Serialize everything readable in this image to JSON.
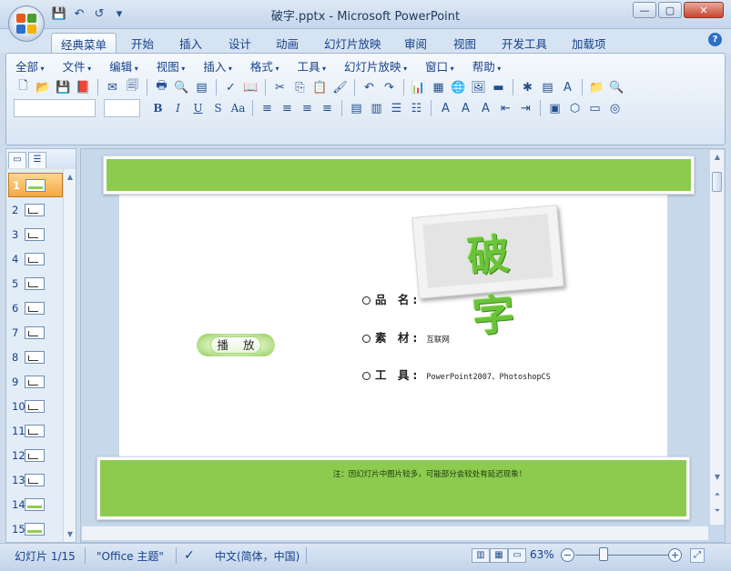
{
  "window": {
    "title": "破字.pptx - Microsoft PowerPoint",
    "controls": [
      "—",
      "▢",
      "✕"
    ]
  },
  "qat": [
    "💾",
    "↶",
    "↺"
  ],
  "ribbon_tabs": [
    "经典菜单",
    "开始",
    "插入",
    "设计",
    "动画",
    "幻灯片放映",
    "审阅",
    "视图",
    "开发工具",
    "加载项"
  ],
  "classic_menu": [
    "全部",
    "文件",
    "编辑",
    "视图",
    "插入",
    "格式",
    "工具",
    "幻灯片放映",
    "窗口",
    "帮助"
  ],
  "toolbar1_icons": [
    "new-icon",
    "open-icon",
    "save-icon",
    "permission-icon",
    "sep",
    "email-icon",
    "publish-icon",
    "sep",
    "print-icon",
    "print-preview-icon",
    "layout-icon",
    "sep",
    "spelling-icon",
    "research-icon",
    "sep",
    "cut-icon",
    "copy-icon",
    "paste-icon",
    "format-painter-icon",
    "sep",
    "undo-icon",
    "redo-icon",
    "sep",
    "chart-icon",
    "table-icon",
    "web-icon",
    "picture-icon",
    "color-icon",
    "sep",
    "new-slide-icon",
    "slide-layout-icon",
    "textbox-icon",
    "sep",
    "folder-icon",
    "find-icon"
  ],
  "toolbar1_glyphs": [
    "🗋",
    "📂",
    "💾",
    "📕",
    "|",
    "✉",
    "🗐",
    "|",
    "🖶",
    "🔍",
    "▤",
    "|",
    "✓",
    "📖",
    "|",
    "✂",
    "⎘",
    "📋",
    "🖌",
    "|",
    "↶",
    "↷",
    "|",
    "📊",
    "▦",
    "🌐",
    "🖼",
    "▬",
    "|",
    "✱",
    "▤",
    "A",
    "|",
    "📁",
    "🔍"
  ],
  "toolbar2_fonts": [
    "B",
    "I",
    "U",
    "S",
    "Aa"
  ],
  "toolbar2_icons": [
    "≡",
    "≡",
    "≡",
    "≡",
    "|",
    "▤",
    "▥",
    "☰",
    "☷",
    "|",
    "A",
    "A",
    "A",
    "⇤",
    "⇥",
    "|",
    "▣",
    "⬡",
    "▭",
    "◎"
  ],
  "slide_pane": {
    "tab_icons": [
      "▭",
      "☰"
    ],
    "numbers": [
      "1",
      "2",
      "3",
      "4",
      "5",
      "6",
      "7",
      "8",
      "9",
      "10",
      "11",
      "12",
      "13",
      "14",
      "15"
    ],
    "active_index": 0
  },
  "slide": {
    "title": "破 字",
    "play_label": "播 放",
    "info": [
      {
        "label": "品 名:",
        "value": ""
      },
      {
        "label": "素 材:",
        "value": "互联网"
      },
      {
        "label": "工 具:",
        "value": "PowerPoint2007、PhotoshopCS"
      }
    ],
    "note": "注：因幻灯片中图片较多，可能部分会较处有延迟现象！"
  },
  "status": {
    "slide_count": "幻灯片 1/15",
    "theme": "\"Office 主题\"",
    "language": "中文(简体，中国)",
    "zoom": "63%"
  },
  "colors": {
    "slide_band_green": "#8dcb4f",
    "title_green": "#6ac33a",
    "ribbon_blue": "#15428b"
  }
}
